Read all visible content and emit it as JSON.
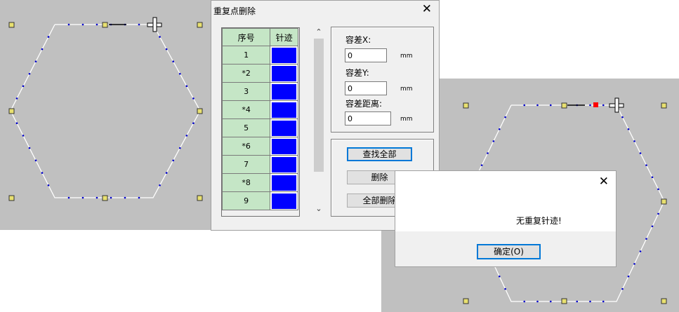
{
  "dialog": {
    "title": "重复点删除",
    "close_glyph": "✕",
    "table": {
      "headers": [
        "序号",
        "针迹"
      ],
      "rows": [
        "1",
        "*2",
        "3",
        "*4",
        "5",
        "*6",
        "7",
        "*8",
        "9"
      ],
      "swatch_color": "#0000ff"
    },
    "scroll": {
      "up_glyph": "⌃",
      "down_glyph": "⌄"
    },
    "tolerance": {
      "x_label": "容差X:",
      "x_value": "0",
      "y_label": "容差Y:",
      "y_value": "0",
      "dist_label": "容差距离:",
      "dist_value": "0",
      "unit": "mm"
    },
    "buttons": {
      "find_all": "查找全部",
      "delete": "删除",
      "delete_all": "全部删除"
    }
  },
  "message_box": {
    "close_glyph": "✕",
    "message": "无重复针迹!",
    "ok_label": "确定(O)"
  },
  "colors": {
    "canvas_bg": "#c0c0c0",
    "stitch_point": "#0000cc",
    "handle": "#e8e070",
    "selected_point": "#ff0000",
    "accent": "#0078d7"
  }
}
